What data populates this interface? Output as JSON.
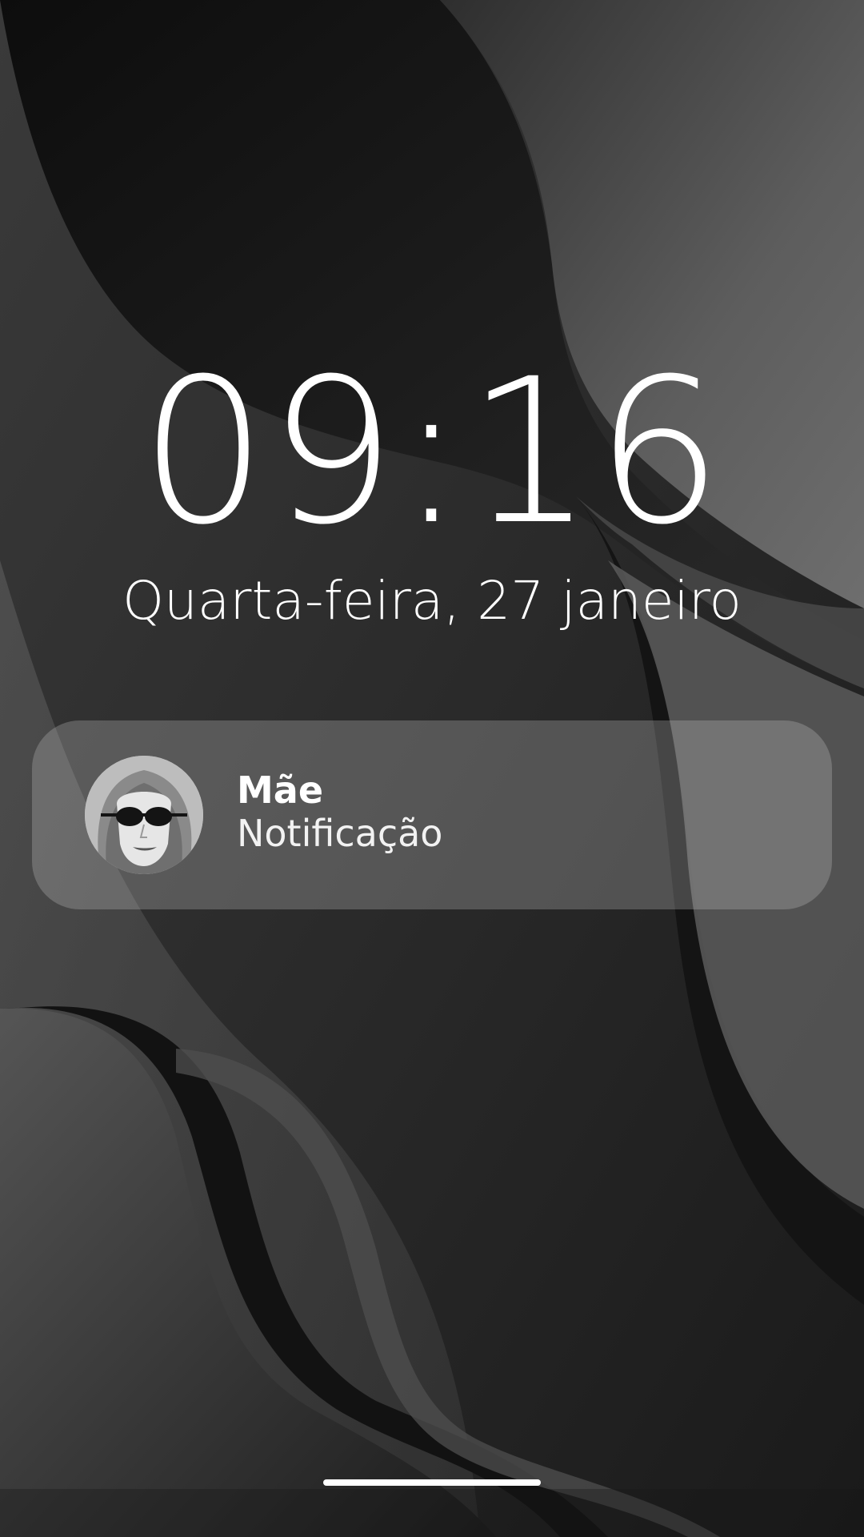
{
  "lock_screen": {
    "time": "09:16",
    "date": "Quarta-feira, 27 janeiro"
  },
  "notification": {
    "title": "Mãe",
    "body": "Notificação",
    "avatar_icon": "avatar-photo"
  },
  "colors": {
    "text": "#ffffff",
    "notification_bg": "rgba(200,200,200,0.28)"
  }
}
